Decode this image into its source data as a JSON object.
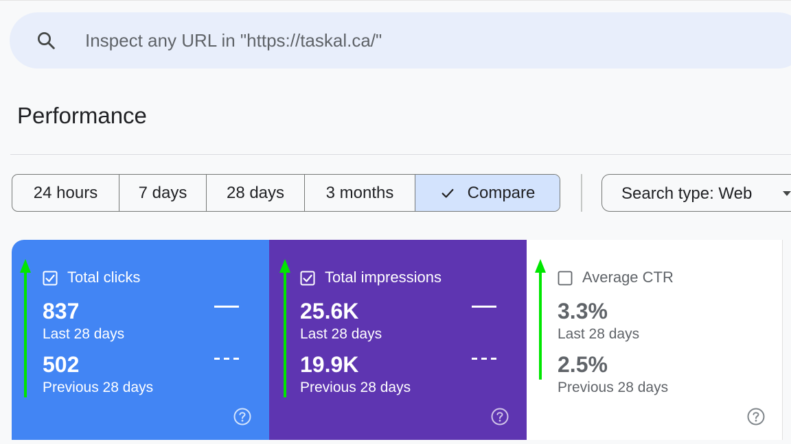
{
  "search": {
    "placeholder": "Inspect any URL in \"https://taskal.ca/\""
  },
  "page": {
    "title": "Performance"
  },
  "date_range": {
    "options": [
      "24 hours",
      "7 days",
      "28 days",
      "3 months"
    ],
    "compare_label": "Compare",
    "selected": "Compare"
  },
  "search_type": {
    "label": "Search type: Web"
  },
  "metrics": [
    {
      "title": "Total clicks",
      "checked": true,
      "current_value": "837",
      "current_period": "Last 28 days",
      "previous_value": "502",
      "previous_period": "Previous 28 days",
      "color": "#4285f4"
    },
    {
      "title": "Total impressions",
      "checked": true,
      "current_value": "25.6K",
      "current_period": "Last 28 days",
      "previous_value": "19.9K",
      "previous_period": "Previous 28 days",
      "color": "#5e35b1"
    },
    {
      "title": "Average CTR",
      "checked": false,
      "current_value": "3.3%",
      "current_period": "Last 28 days",
      "previous_value": "2.5%",
      "previous_period": "Previous 28 days",
      "color": "#ffffff"
    }
  ],
  "icons": {
    "search": "search-icon",
    "check": "check-icon",
    "caret": "caret-down-icon",
    "help": "help-icon",
    "annotation": "green-up-arrow"
  },
  "colors": {
    "accent_blue": "#4285f4",
    "accent_purple": "#5e35b1",
    "selected_chip": "#d3e3fd",
    "annotation_green": "#00e600"
  }
}
